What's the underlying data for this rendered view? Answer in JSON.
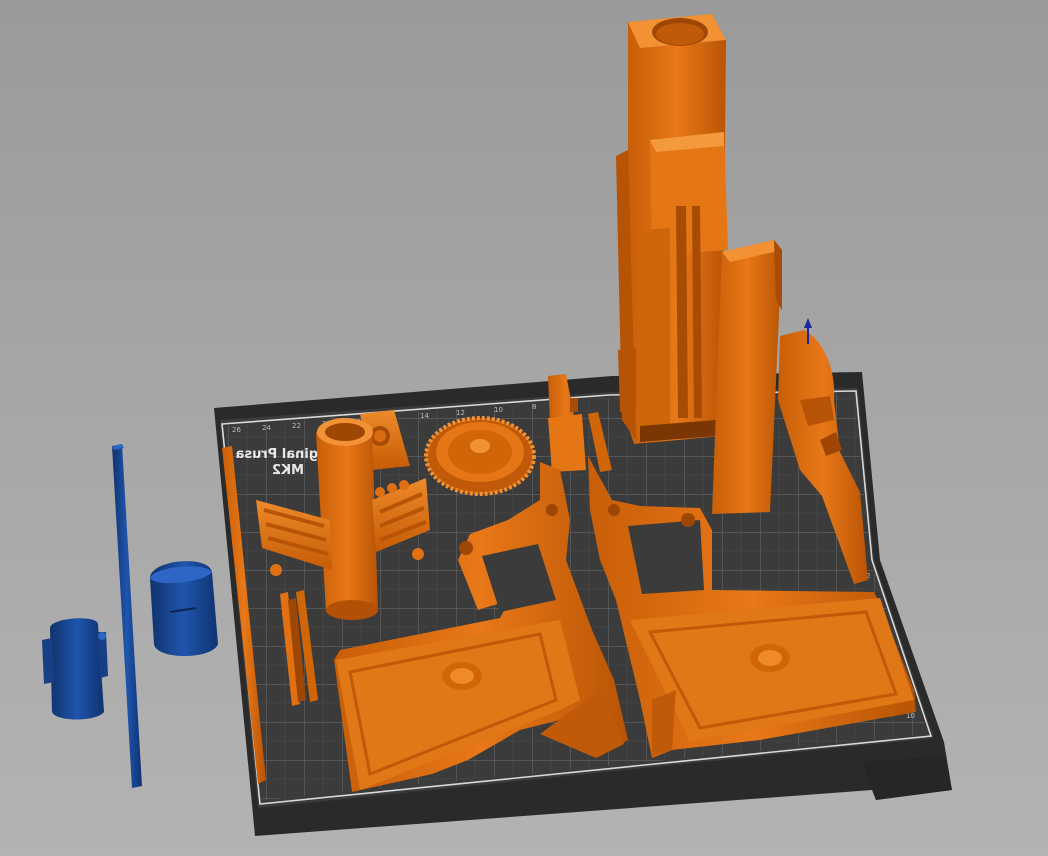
{
  "bed": {
    "label_line1": "Original Prusa",
    "label_line2": "MK2",
    "ticks_top": [
      "26",
      "24",
      "22",
      "20",
      "18",
      "16",
      "14",
      "12",
      "10",
      "8",
      "6",
      "4",
      "2"
    ],
    "ticks_right": [
      "2",
      "4",
      "6",
      "8",
      "10",
      "12",
      "14",
      "16",
      "18",
      "20"
    ]
  },
  "colors": {
    "model_selected": "#e07012",
    "model_outside_bed": "#1a4a9a",
    "bed_surface": "#3a3a3a",
    "bed_grid": "#6e6e6e",
    "background": "#a3a3a3"
  },
  "axis_indicator": {
    "axis": "z",
    "color": "#1a2a9a"
  }
}
